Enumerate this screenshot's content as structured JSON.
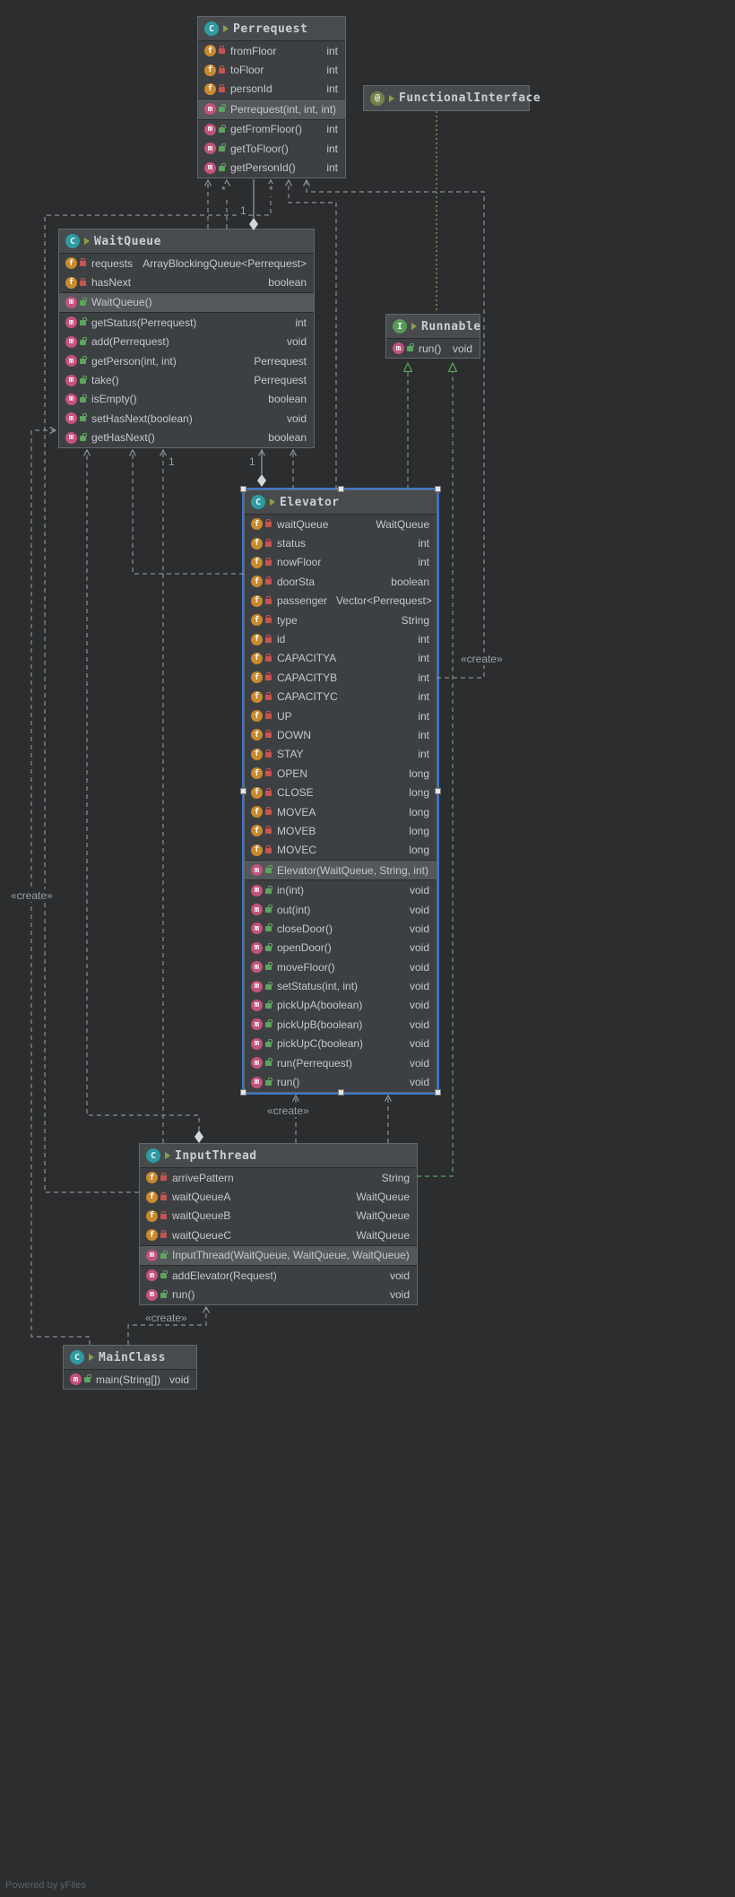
{
  "watermark": "Powered by yFiles",
  "colors": {
    "selection": "#3a76c9",
    "edge": "#8b9096",
    "implements_edge": "#5ea35e",
    "field_icon": "#c98a2e",
    "method_icon": "#c4537c"
  },
  "edge_labels": {
    "create_right": "«create»",
    "create_left": "«create»",
    "create_elevator": "«create»",
    "create_input": "«create»",
    "star_a": "*",
    "star_b": "*",
    "one_top": "1",
    "one_left": "1",
    "one_mid": "1"
  },
  "classes": {
    "perrequest": {
      "kind": "class",
      "icon": "C",
      "name": "Perrequest",
      "fields": [
        {
          "name": "fromFloor",
          "type": "int"
        },
        {
          "name": "toFloor",
          "type": "int"
        },
        {
          "name": "personId",
          "type": "int"
        }
      ],
      "constructors": [
        {
          "name": "Perrequest(int, int, int)",
          "type": ""
        }
      ],
      "methods": [
        {
          "name": "getFromFloor()",
          "type": "int"
        },
        {
          "name": "getToFloor()",
          "type": "int"
        },
        {
          "name": "getPersonId()",
          "type": "int"
        }
      ]
    },
    "functionalinterface": {
      "kind": "annotation",
      "icon": "@",
      "name": "FunctionalInterface"
    },
    "waitqueue": {
      "kind": "class",
      "icon": "C",
      "name": "WaitQueue",
      "fields": [
        {
          "name": "requests",
          "type": "ArrayBlockingQueue<Perrequest>"
        },
        {
          "name": "hasNext",
          "type": "boolean"
        }
      ],
      "constructors": [
        {
          "name": "WaitQueue()",
          "type": ""
        }
      ],
      "methods": [
        {
          "name": "getStatus(Perrequest)",
          "type": "int"
        },
        {
          "name": "add(Perrequest)",
          "type": "void"
        },
        {
          "name": "getPerson(int, int)",
          "type": "Perrequest"
        },
        {
          "name": "take()",
          "type": "Perrequest"
        },
        {
          "name": "isEmpty()",
          "type": "boolean"
        },
        {
          "name": "setHasNext(boolean)",
          "type": "void"
        },
        {
          "name": "getHasNext()",
          "type": "boolean"
        }
      ]
    },
    "runnable": {
      "kind": "interface",
      "icon": "I",
      "name": "Runnable",
      "methods": [
        {
          "name": "run()",
          "type": "void"
        }
      ]
    },
    "elevator": {
      "kind": "class",
      "icon": "C",
      "name": "Elevator",
      "fields": [
        {
          "name": "waitQueue",
          "type": "WaitQueue"
        },
        {
          "name": "status",
          "type": "int"
        },
        {
          "name": "nowFloor",
          "type": "int"
        },
        {
          "name": "doorSta",
          "type": "boolean"
        },
        {
          "name": "passenger",
          "type": "Vector<Perrequest>"
        },
        {
          "name": "type",
          "type": "String"
        },
        {
          "name": "id",
          "type": "int"
        },
        {
          "name": "CAPACITYA",
          "type": "int"
        },
        {
          "name": "CAPACITYB",
          "type": "int"
        },
        {
          "name": "CAPACITYC",
          "type": "int"
        },
        {
          "name": "UP",
          "type": "int"
        },
        {
          "name": "DOWN",
          "type": "int"
        },
        {
          "name": "STAY",
          "type": "int"
        },
        {
          "name": "OPEN",
          "type": "long"
        },
        {
          "name": "CLOSE",
          "type": "long"
        },
        {
          "name": "MOVEA",
          "type": "long"
        },
        {
          "name": "MOVEB",
          "type": "long"
        },
        {
          "name": "MOVEC",
          "type": "long"
        }
      ],
      "constructors": [
        {
          "name": "Elevator(WaitQueue, String, int)",
          "type": ""
        }
      ],
      "methods": [
        {
          "name": "in(int)",
          "type": "void"
        },
        {
          "name": "out(int)",
          "type": "void"
        },
        {
          "name": "closeDoor()",
          "type": "void"
        },
        {
          "name": "openDoor()",
          "type": "void"
        },
        {
          "name": "moveFloor()",
          "type": "void"
        },
        {
          "name": "setStatus(int, int)",
          "type": "void"
        },
        {
          "name": "pickUpA(boolean)",
          "type": "void"
        },
        {
          "name": "pickUpB(boolean)",
          "type": "void"
        },
        {
          "name": "pickUpC(boolean)",
          "type": "void"
        },
        {
          "name": "run(Perrequest)",
          "type": "void"
        },
        {
          "name": "run()",
          "type": "void"
        }
      ]
    },
    "inputthread": {
      "kind": "class",
      "icon": "C",
      "name": "InputThread",
      "fields": [
        {
          "name": "arrivePattern",
          "type": "String"
        },
        {
          "name": "waitQueueA",
          "type": "WaitQueue"
        },
        {
          "name": "waitQueueB",
          "type": "WaitQueue"
        },
        {
          "name": "waitQueueC",
          "type": "WaitQueue"
        }
      ],
      "constructors": [
        {
          "name": "InputThread(WaitQueue, WaitQueue, WaitQueue)",
          "type": ""
        }
      ],
      "methods": [
        {
          "name": "addElevator(Request)",
          "type": "void"
        },
        {
          "name": "run()",
          "type": "void"
        }
      ]
    },
    "mainclass": {
      "kind": "class",
      "icon": "C",
      "name": "MainClass",
      "methods": [
        {
          "name": "main(String[])",
          "type": "void"
        }
      ]
    }
  }
}
